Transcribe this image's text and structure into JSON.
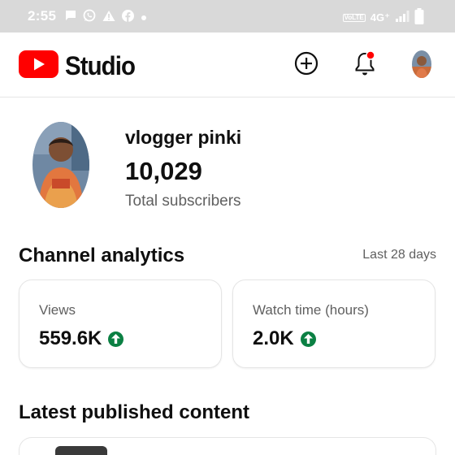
{
  "status_bar": {
    "time": "2:55",
    "left_icons": [
      "chat-icon",
      "whatsapp-icon",
      "alert-icon",
      "facebook-icon",
      "dot-icon"
    ],
    "network": "4G⁺",
    "volte": "VoLTE"
  },
  "header": {
    "logo_text": "Studio",
    "brand_color": "#ff0000",
    "notification_dot_color": "#ff0000"
  },
  "channel": {
    "name": "vlogger pinki",
    "subscribers": "10,029",
    "subscribers_label": "Total subscribers"
  },
  "analytics": {
    "title": "Channel analytics",
    "period": "Last 28 days",
    "cards": [
      {
        "label": "Views",
        "value": "559.6K",
        "trend": "up"
      },
      {
        "label": "Watch time (hours)",
        "value": "2.0K",
        "trend": "up"
      }
    ],
    "trend_color": "#0b8043"
  },
  "latest": {
    "title": "Latest published content"
  }
}
